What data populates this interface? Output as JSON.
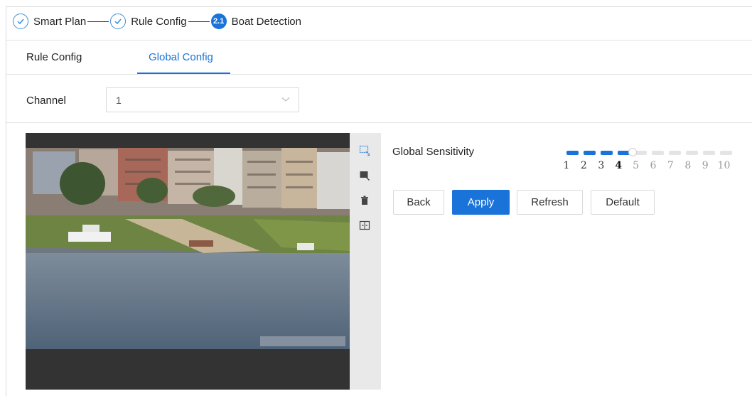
{
  "steps": [
    {
      "label": "Smart Plan",
      "state": "done"
    },
    {
      "label": "Rule Config",
      "state": "done"
    },
    {
      "label": "Boat Detection",
      "state": "active",
      "badge": "2.1"
    }
  ],
  "tabs": {
    "rule_config": "Rule Config",
    "global_config": "Global Config",
    "active": "global_config"
  },
  "channel": {
    "label": "Channel",
    "value": "1"
  },
  "toolbar_icons": [
    "draw-rule-icon",
    "draw-area-icon",
    "delete-icon",
    "split-view-icon"
  ],
  "sensitivity": {
    "label": "Global Sensitivity",
    "value": 4,
    "min": 1,
    "max": 10,
    "ticks": [
      "1",
      "2",
      "3",
      "4",
      "5",
      "6",
      "7",
      "8",
      "9",
      "10"
    ]
  },
  "buttons": {
    "back": "Back",
    "apply": "Apply",
    "refresh": "Refresh",
    "default": "Default"
  },
  "colors": {
    "accent": "#1a73d9",
    "border": "#d9d9d9"
  }
}
